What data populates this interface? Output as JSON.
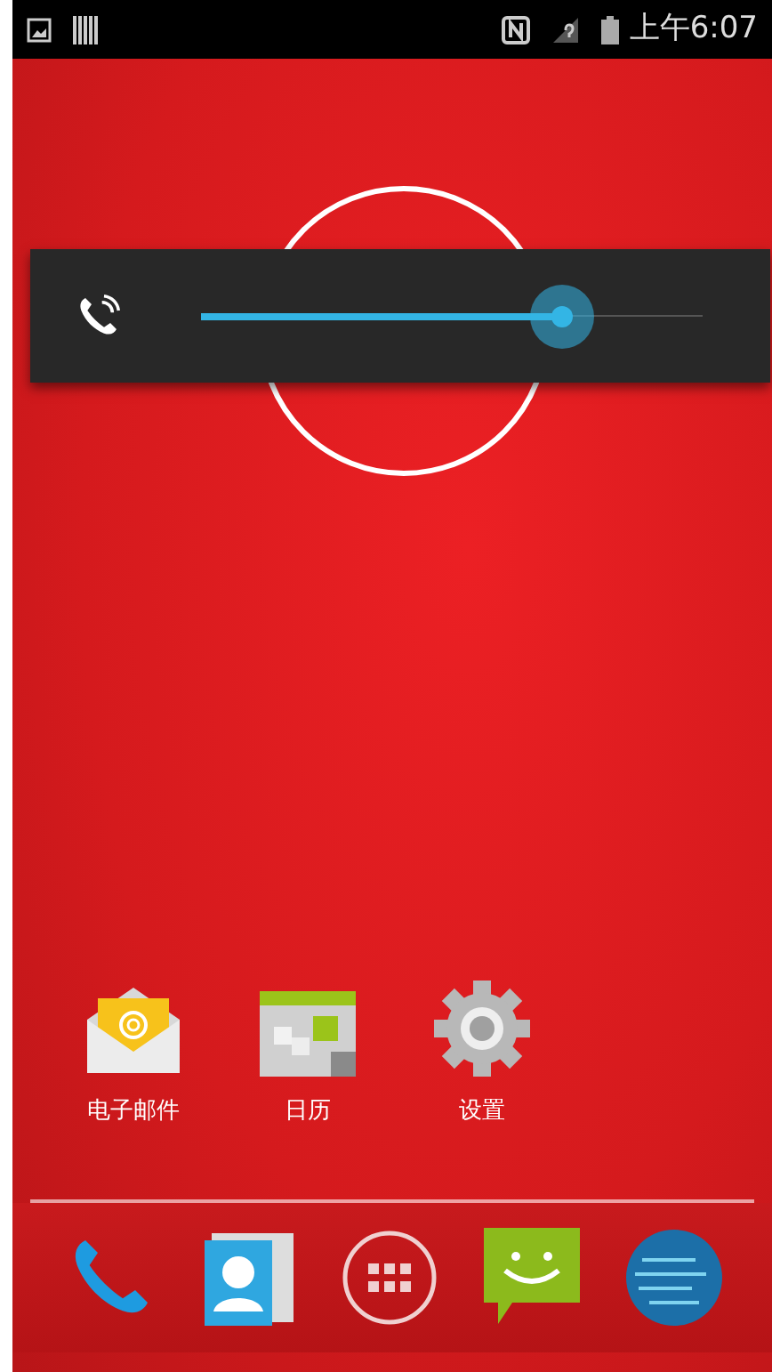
{
  "status_bar": {
    "time": "上午6:07"
  },
  "volume_panel": {
    "level": 0.72
  },
  "apps": [
    {
      "kind": "email",
      "label": "电子邮件"
    },
    {
      "kind": "calendar",
      "label": "日历"
    },
    {
      "kind": "settings",
      "label": "设置"
    }
  ]
}
